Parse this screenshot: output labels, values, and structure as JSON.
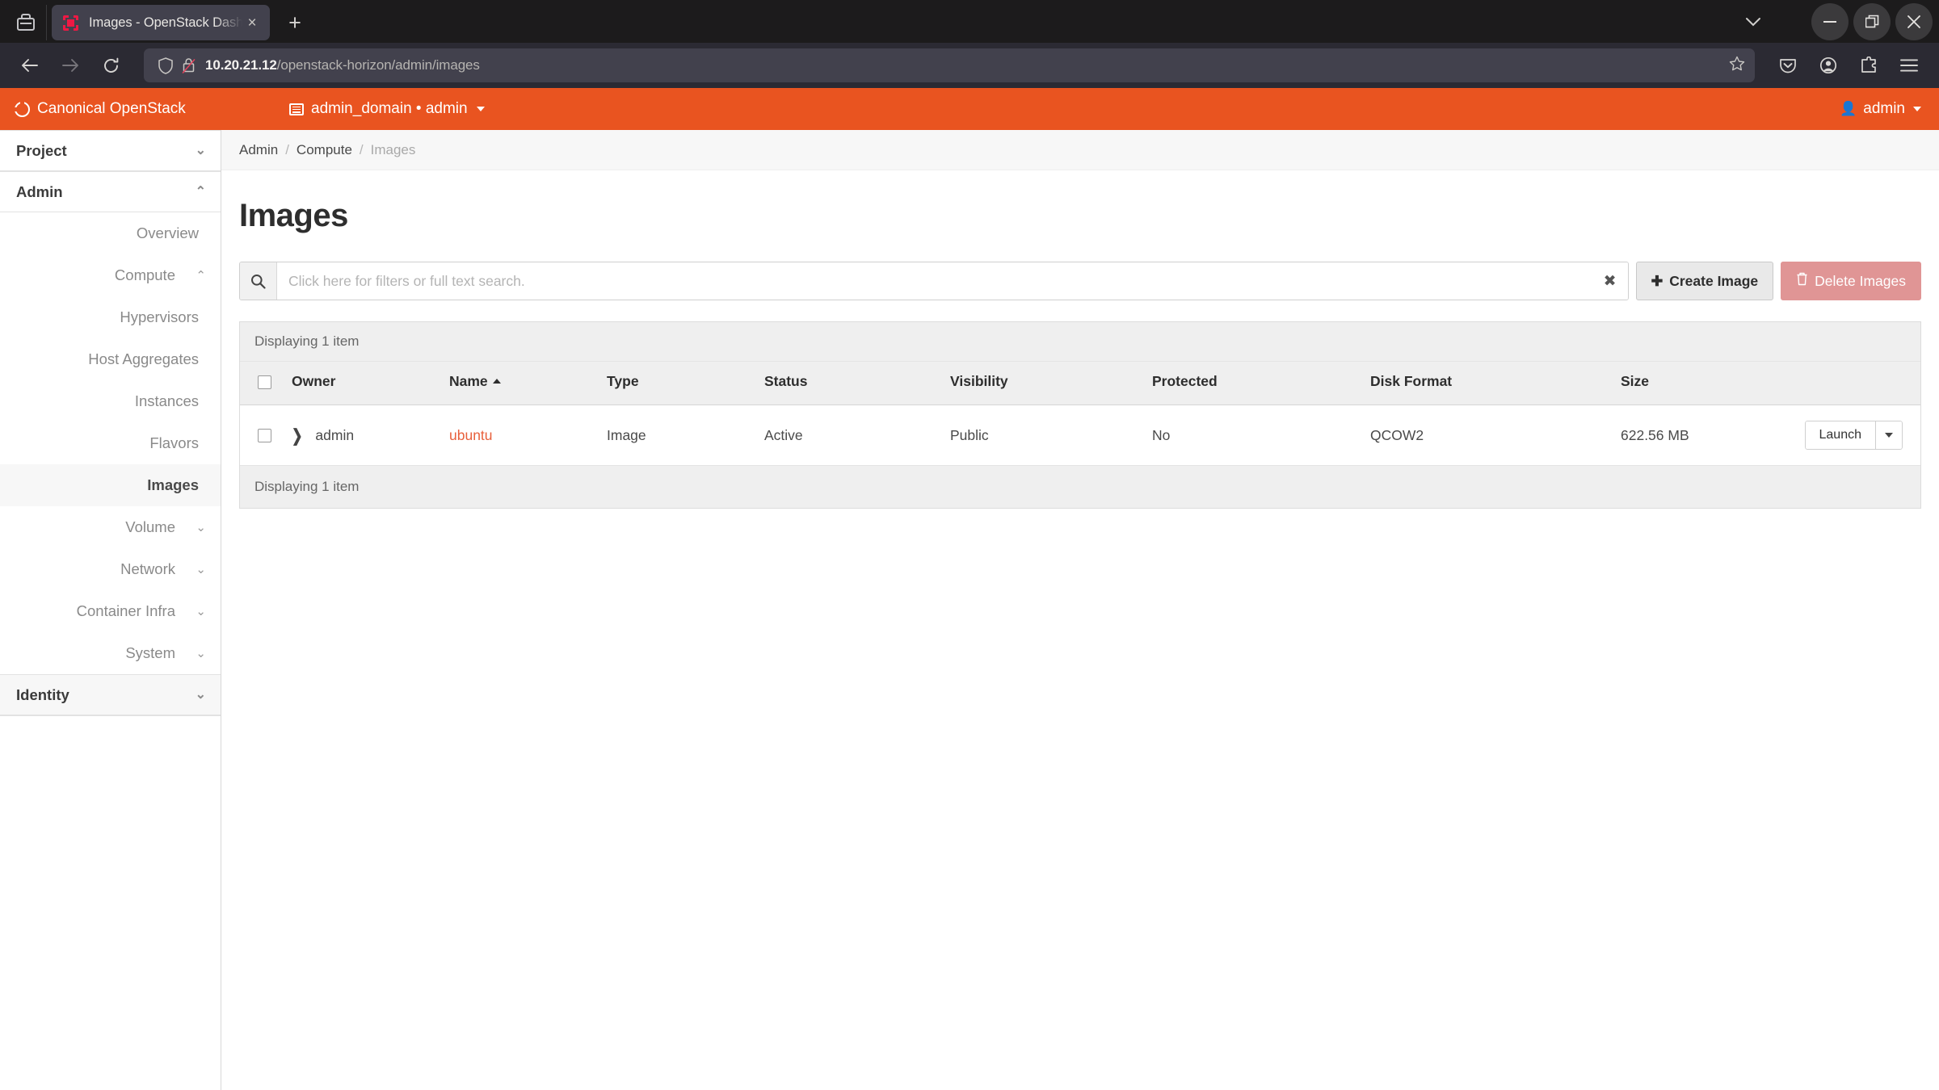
{
  "browser": {
    "firefox_view_icon": "firefox-view-icon",
    "tab": {
      "title": "Images - OpenStack Dash",
      "favicon": "openstack-favicon",
      "close_label": "×"
    },
    "new_tab_label": "+",
    "window_controls": {
      "tab_list_label": "⌄",
      "minimize_label": "—",
      "restore_label": "❐",
      "close_label": "✕"
    },
    "nav": {
      "back_label": "←",
      "forward_label": "→",
      "reload_label": "⟳"
    },
    "url": {
      "host": "10.20.21.12",
      "path": "/openstack-horizon/admin/images",
      "shield_icon": "tracking-protection-shield-icon",
      "lock_icon": "insecure-lock-icon",
      "bookmark_icon": "bookmark-star-icon"
    },
    "toolbar_right": {
      "pocket": "pocket-icon",
      "account": "account-icon",
      "extensions": "extensions-icon",
      "menu": "hamburger-menu-icon"
    }
  },
  "header": {
    "brand": "Canonical OpenStack",
    "brand_icon": "openstack-ring-logo",
    "context": "admin_domain • admin",
    "context_icon": "project-list-icon",
    "user": "admin",
    "user_icon": "user-icon",
    "accent_color": "#e95420"
  },
  "sidebar": {
    "groups": [
      {
        "label": "Project",
        "expanded": false,
        "chevron": "chevron-down-icon",
        "items": []
      },
      {
        "label": "Admin",
        "expanded": true,
        "chevron": "chevron-up-icon",
        "items": [
          {
            "label": "Overview",
            "level": 2,
            "active": false,
            "chevron": null
          },
          {
            "label": "Compute",
            "level": 2,
            "active": false,
            "chevron": "chevron-up-icon"
          },
          {
            "label": "Hypervisors",
            "level": 3,
            "active": false,
            "chevron": null
          },
          {
            "label": "Host Aggregates",
            "level": 3,
            "active": false,
            "chevron": null
          },
          {
            "label": "Instances",
            "level": 3,
            "active": false,
            "chevron": null
          },
          {
            "label": "Flavors",
            "level": 3,
            "active": false,
            "chevron": null
          },
          {
            "label": "Images",
            "level": 3,
            "active": true,
            "chevron": null
          },
          {
            "label": "Volume",
            "level": 2,
            "active": false,
            "chevron": "chevron-down-icon"
          },
          {
            "label": "Network",
            "level": 2,
            "active": false,
            "chevron": "chevron-down-icon"
          },
          {
            "label": "Container Infra",
            "level": 2,
            "active": false,
            "chevron": "chevron-down-icon"
          },
          {
            "label": "System",
            "level": 2,
            "active": false,
            "chevron": "chevron-down-icon"
          }
        ]
      },
      {
        "label": "Identity",
        "expanded": false,
        "chevron": "chevron-down-icon",
        "items": []
      }
    ]
  },
  "breadcrumb": {
    "items": [
      "Admin",
      "Compute",
      "Images"
    ],
    "separator": "/"
  },
  "main": {
    "title": "Images",
    "search": {
      "placeholder": "Click here for filters or full text search.",
      "value": "",
      "icon": "search-icon",
      "clear_label": "✖"
    },
    "create_button": {
      "label": "Create Image",
      "icon": "plus-icon"
    },
    "delete_button": {
      "label": "Delete Images",
      "icon": "trash-icon"
    },
    "table": {
      "count_top": "Displaying 1 item",
      "count_bottom": "Displaying 1 item",
      "sort_column": "Name",
      "sort_direction": "asc",
      "columns": [
        "Owner",
        "Name",
        "Type",
        "Status",
        "Visibility",
        "Protected",
        "Disk Format",
        "Size"
      ],
      "rows": [
        {
          "owner": "admin",
          "name": "ubuntu",
          "type": "Image",
          "status": "Active",
          "visibility": "Public",
          "protected": "No",
          "disk_format": "QCOW2",
          "size": "622.56 MB",
          "action_label": "Launch"
        }
      ]
    }
  }
}
